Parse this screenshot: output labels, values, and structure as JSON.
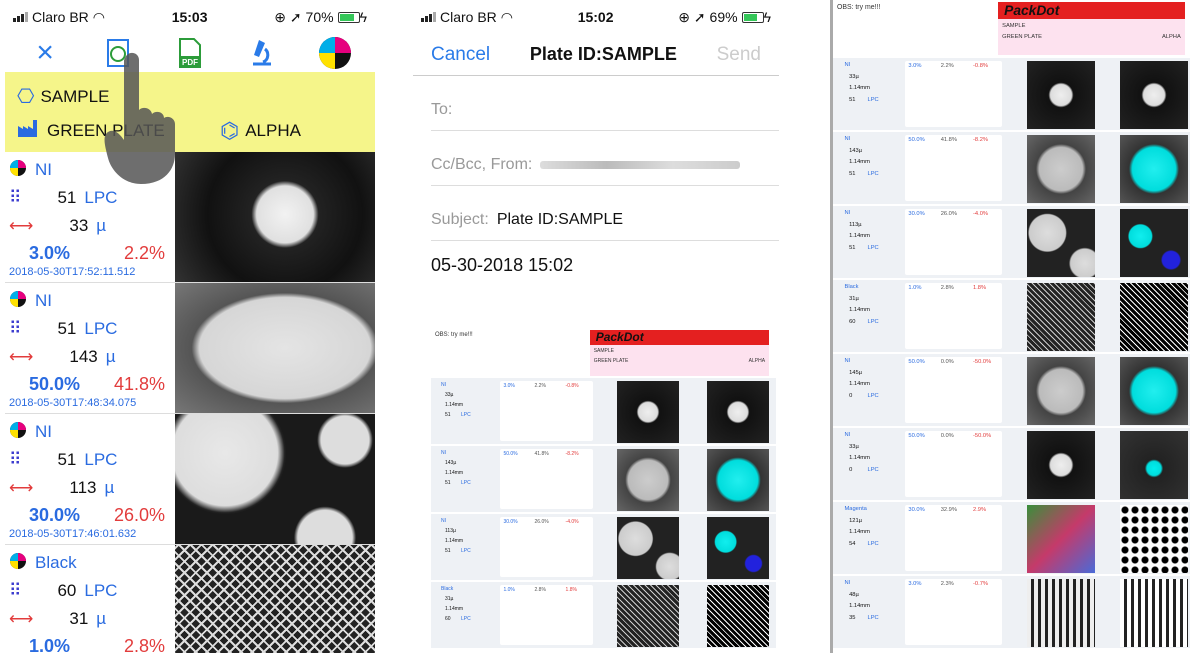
{
  "p1": {
    "status": {
      "carrier": "Claro BR",
      "time": "15:03",
      "battery": "70%"
    },
    "toolbar": {
      "close": "×"
    },
    "plate": {
      "id": "SAMPLE",
      "plate": "GREEN PLATE",
      "type": "ALPHA"
    },
    "rows": [
      {
        "ink": "NI",
        "lpc": "51",
        "lpc_unit": "LPC",
        "size": "33",
        "size_unit": "µ",
        "p1": "3.0%",
        "p2": "2.2%",
        "ts": "2018-05-30T17:52:11.512"
      },
      {
        "ink": "NI",
        "lpc": "51",
        "lpc_unit": "LPC",
        "size": "143",
        "size_unit": "µ",
        "p1": "50.0%",
        "p2": "41.8%",
        "ts": "2018-05-30T17:48:34.075"
      },
      {
        "ink": "NI",
        "lpc": "51",
        "lpc_unit": "LPC",
        "size": "113",
        "size_unit": "µ",
        "p1": "30.0%",
        "p2": "26.0%",
        "ts": "2018-05-30T17:46:01.632"
      },
      {
        "ink": "Black",
        "lpc": "60",
        "lpc_unit": "LPC",
        "size": "31",
        "size_unit": "µ",
        "p1": "1.0%",
        "p2": "2.8%",
        "ts": ""
      }
    ]
  },
  "p2": {
    "status": {
      "carrier": "Claro BR",
      "time": "15:02",
      "battery": "69%"
    },
    "nav": {
      "cancel": "Cancel",
      "title": "Plate ID:SAMPLE",
      "send": "Send"
    },
    "to": "To:",
    "cc": "Cc/Bcc, From:",
    "subject_label": "Subject:",
    "subject": "Plate ID:SAMPLE",
    "date": "05-30-2018 15:02"
  },
  "mini": {
    "obs": "OBS:  try me!!!",
    "title": "PackDot",
    "sample": "SAMPLE",
    "plate": "GREEN PLATE",
    "alpha": "ALPHA",
    "size": "1.14mm",
    "lpc": "LPC",
    "rows2": [
      {
        "ink": "NI",
        "a": "3.0%",
        "b": "2.2%",
        "c": "-0.8%",
        "s": "33µ",
        "l": "51"
      },
      {
        "ink": "NI",
        "a": "50.0%",
        "b": "41.8%",
        "c": "-8.2%",
        "s": "143µ",
        "l": "51"
      },
      {
        "ink": "NI",
        "a": "30.0%",
        "b": "26.0%",
        "c": "-4.0%",
        "s": "113µ",
        "l": "51"
      },
      {
        "ink": "Black",
        "a": "1.0%",
        "b": "2.8%",
        "c": "1.8%",
        "s": "31µ",
        "l": "60"
      }
    ],
    "rows3": [
      {
        "ink": "NI",
        "a": "3.0%",
        "b": "2.2%",
        "c": "-0.8%",
        "s": "33µ",
        "l": "51"
      },
      {
        "ink": "NI",
        "a": "50.0%",
        "b": "41.8%",
        "c": "-8.2%",
        "s": "143µ",
        "l": "51"
      },
      {
        "ink": "NI",
        "a": "30.0%",
        "b": "26.0%",
        "c": "-4.0%",
        "s": "113µ",
        "l": "51"
      },
      {
        "ink": "Black",
        "a": "1.0%",
        "b": "2.8%",
        "c": "1.8%",
        "s": "31µ",
        "l": "60"
      },
      {
        "ink": "NI",
        "a": "50.0%",
        "b": "0.0%",
        "c": "-50.0%",
        "s": "145µ",
        "l": "0"
      },
      {
        "ink": "NI",
        "a": "50.0%",
        "b": "0.0%",
        "c": "-50.0%",
        "s": "33µ",
        "l": "0"
      },
      {
        "ink": "Magenta",
        "a": "30.0%",
        "b": "32.9%",
        "c": "2.9%",
        "s": "121µ",
        "l": "54"
      },
      {
        "ink": "NI",
        "a": "3.0%",
        "b": "2.3%",
        "c": "-0.7%",
        "s": "48µ",
        "l": "35"
      }
    ]
  }
}
